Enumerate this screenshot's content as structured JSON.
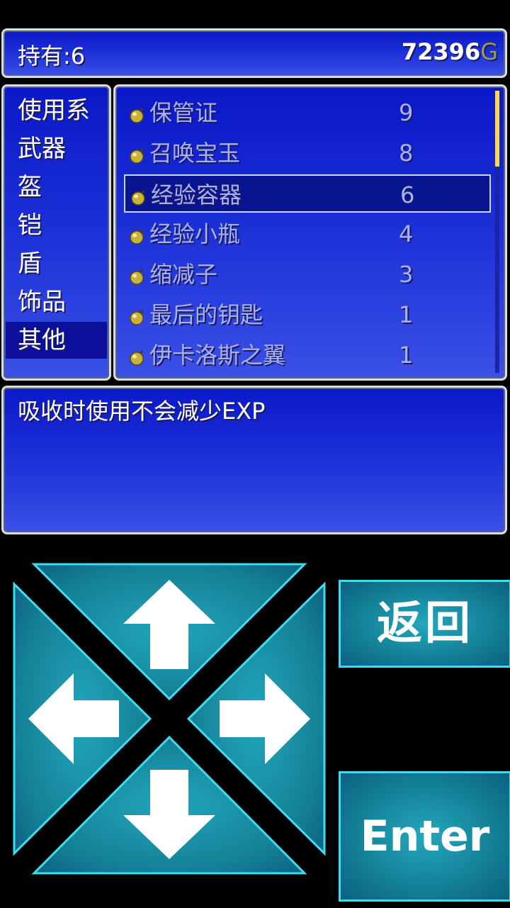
{
  "header": {
    "held_label": "持有:6",
    "gold_amount": "72396",
    "gold_unit": "G"
  },
  "categories": [
    {
      "label": "使用系",
      "selected": false
    },
    {
      "label": "武器",
      "selected": false
    },
    {
      "label": "盔",
      "selected": false
    },
    {
      "label": "铠",
      "selected": false
    },
    {
      "label": "盾",
      "selected": false
    },
    {
      "label": "饰品",
      "selected": false
    },
    {
      "label": "其他",
      "selected": true
    }
  ],
  "items": [
    {
      "name": "保管证",
      "count": "9",
      "icon": "pouch-icon",
      "selected": false
    },
    {
      "name": "召唤宝玉",
      "count": "8",
      "icon": "pouch-icon",
      "selected": false
    },
    {
      "name": "经验容器",
      "count": "6",
      "icon": "pouch-icon",
      "selected": true
    },
    {
      "name": "经验小瓶",
      "count": "4",
      "icon": "pouch-icon",
      "selected": false
    },
    {
      "name": "缩减子",
      "count": "3",
      "icon": "pouch-icon",
      "selected": false
    },
    {
      "name": "最后的钥匙",
      "count": "1",
      "icon": "pouch-icon",
      "selected": false
    },
    {
      "name": "伊卡洛斯之翼",
      "count": "1",
      "icon": "pouch-icon",
      "selected": false
    }
  ],
  "scroll": {
    "position": 0,
    "visible_fraction": 0.27
  },
  "description": "吸收时使用不会减少EXP",
  "controls": {
    "back_label": "返回",
    "enter_label": "Enter",
    "dpad": [
      "arrow-up-icon",
      "arrow-left-icon",
      "arrow-right-icon",
      "arrow-down-icon"
    ]
  },
  "colors": {
    "window_blue": "#1a2ed6",
    "window_border": "#d9ddd9",
    "button_teal": "#137e96",
    "button_border": "#3fdcf0",
    "scroll_thumb": "#ffd84a"
  }
}
